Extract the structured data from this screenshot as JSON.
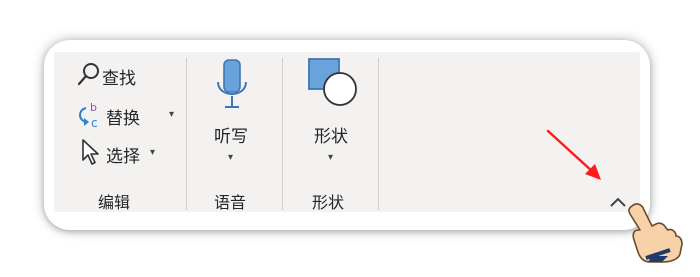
{
  "editing": {
    "find_label": "查找",
    "replace_label": "替换",
    "select_label": "选择",
    "group_label": "编辑"
  },
  "voice": {
    "dictate_label": "听写",
    "group_label": "语音"
  },
  "shapes": {
    "shapes_label": "形状",
    "group_label": "形状"
  },
  "icons": {
    "find": "search-icon",
    "replace": "replace-icon",
    "select": "cursor-arrow-icon",
    "dictate": "microphone-icon",
    "shapes": "shapes-icon",
    "collapse": "chevron-up-icon",
    "annotation_arrow": "red-arrow-icon",
    "pointer": "hand-pointer-icon"
  },
  "colors": {
    "ribbon_bg": "#f3f2f1",
    "icon_blue": "#4a86c8",
    "icon_blue_fill": "#6aa3db",
    "annotation_red": "#ff1a1a"
  }
}
